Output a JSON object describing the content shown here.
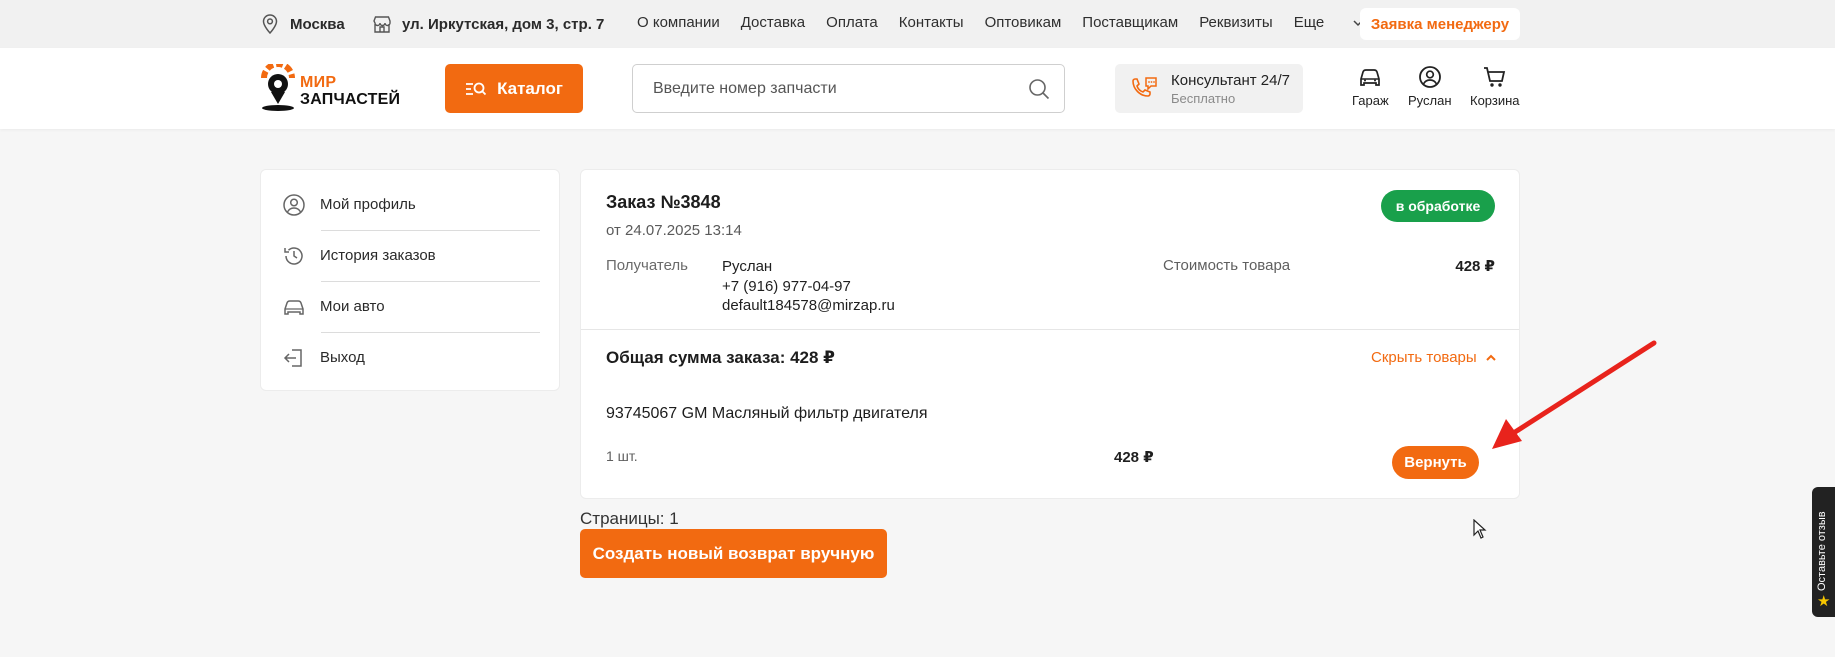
{
  "topbar": {
    "city": "Москва",
    "address": "ул. Иркутская, дом 3, стр. 7",
    "nav": [
      "О компании",
      "Доставка",
      "Оплата",
      "Контакты",
      "Оптовикам",
      "Поставщикам",
      "Реквизиты"
    ],
    "more_label": "Еще",
    "manager_button": "Заявка менеджеру"
  },
  "header": {
    "logo_line1": "МИР",
    "logo_line2": "ЗАПЧАСТЕЙ",
    "catalog_button": "Каталог",
    "search_placeholder": "Введите номер запчасти",
    "consultant_title": "Консультант 24/7",
    "consultant_subtitle": "Бесплатно",
    "garage_label": "Гараж",
    "user_label": "Руслан",
    "cart_label": "Корзина"
  },
  "sidebar": {
    "items": [
      {
        "label": "Мой профиль",
        "icon": "user-circle-icon"
      },
      {
        "label": "История заказов",
        "icon": "history-icon"
      },
      {
        "label": "Мои авто",
        "icon": "car-icon"
      },
      {
        "label": "Выход",
        "icon": "logout-icon"
      }
    ]
  },
  "order": {
    "title": "Заказ №3848",
    "date": "от 24.07.2025 13:14",
    "status": "в обработке",
    "status_color": "#19a04b",
    "recipient_label": "Получатель",
    "recipient_name": "Руслан",
    "recipient_phone": "+7 (916) 977-04-97",
    "recipient_email": "default184578@mirzap.ru",
    "cost_label": "Стоимость товара",
    "cost_value": "428 ₽",
    "total": "Общая сумма заказа: 428 ₽",
    "hide_items": "Скрыть товары",
    "items": [
      {
        "name": "93745067 GM Масляный фильтр двигателя",
        "qty": "1 шт.",
        "price": "428 ₽",
        "return_label": "Вернуть"
      }
    ]
  },
  "pagination": "Страницы: 1",
  "new_return_button": "Создать новый возврат вручную",
  "feedback_tab": "Оставьте отзыв",
  "accent_color": "#f26a11"
}
